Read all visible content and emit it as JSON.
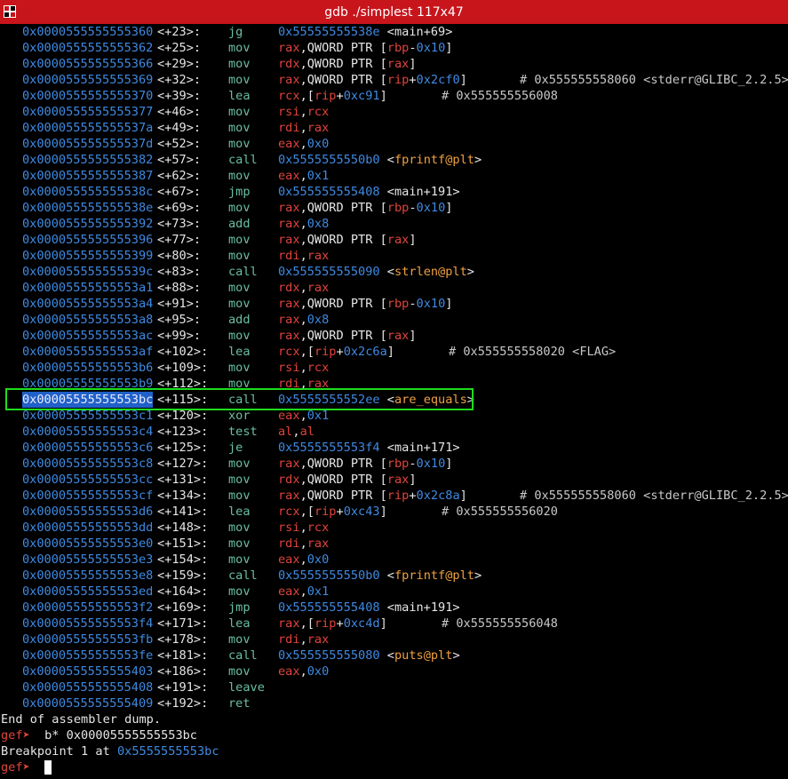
{
  "window": {
    "title": "gdb ./simplest 117x47"
  },
  "rows": [
    {
      "addr": "0x0000555555555360",
      "off": "<+23>:",
      "mn": "jg",
      "ops": [
        {
          "t": "0x55555555538e",
          "c": "num"
        },
        {
          "t": " ",
          "c": "txt"
        },
        {
          "t": "<",
          "c": "txt"
        },
        {
          "t": "main+69",
          "c": "txt"
        },
        {
          "t": ">",
          "c": "txt"
        }
      ],
      "cm": ""
    },
    {
      "addr": "0x0000555555555362",
      "off": "<+25>:",
      "mn": "mov",
      "ops": [
        {
          "t": "rax",
          "c": "reg"
        },
        {
          "t": ",QWORD PTR [",
          "c": "txt"
        },
        {
          "t": "rbp",
          "c": "reg"
        },
        {
          "t": "-",
          "c": "txt"
        },
        {
          "t": "0x10",
          "c": "num"
        },
        {
          "t": "]",
          "c": "txt"
        }
      ],
      "cm": ""
    },
    {
      "addr": "0x0000555555555366",
      "off": "<+29>:",
      "mn": "mov",
      "ops": [
        {
          "t": "rdx",
          "c": "reg"
        },
        {
          "t": ",QWORD PTR [",
          "c": "txt"
        },
        {
          "t": "rax",
          "c": "reg"
        },
        {
          "t": "]",
          "c": "txt"
        }
      ],
      "cm": ""
    },
    {
      "addr": "0x0000555555555369",
      "off": "<+32>:",
      "mn": "mov",
      "ops": [
        {
          "t": "rax",
          "c": "reg"
        },
        {
          "t": ",QWORD PTR [",
          "c": "txt"
        },
        {
          "t": "rip",
          "c": "reg"
        },
        {
          "t": "+",
          "c": "txt"
        },
        {
          "t": "0x2cf0",
          "c": "num"
        },
        {
          "t": "]",
          "c": "txt"
        }
      ],
      "cm": "# 0x555555558060 <stderr@GLIBC_2.2.5>",
      "cmx": 585
    },
    {
      "addr": "0x0000555555555370",
      "off": "<+39>:",
      "mn": "lea",
      "ops": [
        {
          "t": "rcx",
          "c": "reg"
        },
        {
          "t": ",[",
          "c": "txt"
        },
        {
          "t": "rip",
          "c": "reg"
        },
        {
          "t": "+",
          "c": "txt"
        },
        {
          "t": "0xc91",
          "c": "num"
        },
        {
          "t": "]",
          "c": "txt"
        }
      ],
      "cm": "# 0x555555556008",
      "cmx": 497
    },
    {
      "addr": "0x0000555555555377",
      "off": "<+46>:",
      "mn": "mov",
      "ops": [
        {
          "t": "rsi",
          "c": "reg"
        },
        {
          "t": ",",
          "c": "txt"
        },
        {
          "t": "rcx",
          "c": "reg"
        }
      ],
      "cm": ""
    },
    {
      "addr": "0x000055555555537a",
      "off": "<+49>:",
      "mn": "mov",
      "ops": [
        {
          "t": "rdi",
          "c": "reg"
        },
        {
          "t": ",",
          "c": "txt"
        },
        {
          "t": "rax",
          "c": "reg"
        }
      ],
      "cm": ""
    },
    {
      "addr": "0x000055555555537d",
      "off": "<+52>:",
      "mn": "mov",
      "ops": [
        {
          "t": "eax",
          "c": "reg"
        },
        {
          "t": ",",
          "c": "txt"
        },
        {
          "t": "0x0",
          "c": "num"
        }
      ],
      "cm": ""
    },
    {
      "addr": "0x0000555555555382",
      "off": "<+57>:",
      "mn": "call",
      "ops": [
        {
          "t": "0x5555555550b0",
          "c": "num"
        },
        {
          "t": " <",
          "c": "txt"
        },
        {
          "t": "fprintf@plt",
          "c": "sym"
        },
        {
          "t": ">",
          "c": "txt"
        }
      ],
      "cm": ""
    },
    {
      "addr": "0x0000555555555387",
      "off": "<+62>:",
      "mn": "mov",
      "ops": [
        {
          "t": "eax",
          "c": "reg"
        },
        {
          "t": ",",
          "c": "txt"
        },
        {
          "t": "0x1",
          "c": "num"
        }
      ],
      "cm": ""
    },
    {
      "addr": "0x000055555555538c",
      "off": "<+67>:",
      "mn": "jmp",
      "ops": [
        {
          "t": "0x555555555408",
          "c": "num"
        },
        {
          "t": " <main+191>",
          "c": "txt"
        }
      ],
      "cm": ""
    },
    {
      "addr": "0x000055555555538e",
      "off": "<+69>:",
      "mn": "mov",
      "ops": [
        {
          "t": "rax",
          "c": "reg"
        },
        {
          "t": ",QWORD PTR [",
          "c": "txt"
        },
        {
          "t": "rbp",
          "c": "reg"
        },
        {
          "t": "-",
          "c": "txt"
        },
        {
          "t": "0x10",
          "c": "num"
        },
        {
          "t": "]",
          "c": "txt"
        }
      ],
      "cm": ""
    },
    {
      "addr": "0x0000555555555392",
      "off": "<+73>:",
      "mn": "add",
      "ops": [
        {
          "t": "rax",
          "c": "reg"
        },
        {
          "t": ",",
          "c": "txt"
        },
        {
          "t": "0x8",
          "c": "num"
        }
      ],
      "cm": ""
    },
    {
      "addr": "0x0000555555555396",
      "off": "<+77>:",
      "mn": "mov",
      "ops": [
        {
          "t": "rax",
          "c": "reg"
        },
        {
          "t": ",QWORD PTR [",
          "c": "txt"
        },
        {
          "t": "rax",
          "c": "reg"
        },
        {
          "t": "]",
          "c": "txt"
        }
      ],
      "cm": ""
    },
    {
      "addr": "0x0000555555555399",
      "off": "<+80>:",
      "mn": "mov",
      "ops": [
        {
          "t": "rdi",
          "c": "reg"
        },
        {
          "t": ",",
          "c": "txt"
        },
        {
          "t": "rax",
          "c": "reg"
        }
      ],
      "cm": ""
    },
    {
      "addr": "0x000055555555539c",
      "off": "<+83>:",
      "mn": "call",
      "ops": [
        {
          "t": "0x555555555090",
          "c": "num"
        },
        {
          "t": " <",
          "c": "txt"
        },
        {
          "t": "strlen@plt",
          "c": "sym"
        },
        {
          "t": ">",
          "c": "txt"
        }
      ],
      "cm": ""
    },
    {
      "addr": "0x00005555555553a1",
      "off": "<+88>:",
      "mn": "mov",
      "ops": [
        {
          "t": "rdx",
          "c": "reg"
        },
        {
          "t": ",",
          "c": "txt"
        },
        {
          "t": "rax",
          "c": "reg"
        }
      ],
      "cm": ""
    },
    {
      "addr": "0x00005555555553a4",
      "off": "<+91>:",
      "mn": "mov",
      "ops": [
        {
          "t": "rax",
          "c": "reg"
        },
        {
          "t": ",QWORD PTR [",
          "c": "txt"
        },
        {
          "t": "rbp",
          "c": "reg"
        },
        {
          "t": "-",
          "c": "txt"
        },
        {
          "t": "0x10",
          "c": "num"
        },
        {
          "t": "]",
          "c": "txt"
        }
      ],
      "cm": ""
    },
    {
      "addr": "0x00005555555553a8",
      "off": "<+95>:",
      "mn": "add",
      "ops": [
        {
          "t": "rax",
          "c": "reg"
        },
        {
          "t": ",",
          "c": "txt"
        },
        {
          "t": "0x8",
          "c": "num"
        }
      ],
      "cm": ""
    },
    {
      "addr": "0x00005555555553ac",
      "off": "<+99>:",
      "mn": "mov",
      "ops": [
        {
          "t": "rax",
          "c": "reg"
        },
        {
          "t": ",QWORD PTR [",
          "c": "txt"
        },
        {
          "t": "rax",
          "c": "reg"
        },
        {
          "t": "]",
          "c": "txt"
        }
      ],
      "cm": ""
    },
    {
      "addr": "0x00005555555553af",
      "off": "<+102>:",
      "mn": "lea",
      "ops": [
        {
          "t": "rcx",
          "c": "reg"
        },
        {
          "t": ",[",
          "c": "txt"
        },
        {
          "t": "rip",
          "c": "reg"
        },
        {
          "t": "+",
          "c": "txt"
        },
        {
          "t": "0x2c6a",
          "c": "num"
        },
        {
          "t": "]",
          "c": "txt"
        }
      ],
      "cm": "# 0x555555558020 <FLAG>",
      "cmx": 505
    },
    {
      "addr": "0x00005555555553b6",
      "off": "<+109>:",
      "mn": "mov",
      "ops": [
        {
          "t": "rsi",
          "c": "reg"
        },
        {
          "t": ",",
          "c": "txt"
        },
        {
          "t": "rcx",
          "c": "reg"
        }
      ],
      "cm": ""
    },
    {
      "addr": "0x00005555555553b9",
      "off": "<+112>:",
      "mn": "mov",
      "ops": [
        {
          "t": "rdi",
          "c": "reg"
        },
        {
          "t": ",",
          "c": "txt"
        },
        {
          "t": "rax",
          "c": "reg"
        }
      ],
      "cm": ""
    },
    {
      "addr": "0x00005555555553bc",
      "off": "<+115>:",
      "mn": "call",
      "ops": [
        {
          "t": "0x5555555552ee",
          "c": "num"
        },
        {
          "t": " <",
          "c": "txt"
        },
        {
          "t": "are_equals",
          "c": "sym"
        },
        {
          "t": ">",
          "c": "txt"
        }
      ],
      "cm": "",
      "selected": true
    },
    {
      "addr": "0x00005555555553c1",
      "off": "<+120>:",
      "mn": "xor",
      "ops": [
        {
          "t": "eax",
          "c": "reg"
        },
        {
          "t": ",",
          "c": "txt"
        },
        {
          "t": "0x1",
          "c": "num"
        }
      ],
      "cm": ""
    },
    {
      "addr": "0x00005555555553c4",
      "off": "<+123>:",
      "mn": "test",
      "ops": [
        {
          "t": "al",
          "c": "reg"
        },
        {
          "t": ",",
          "c": "txt"
        },
        {
          "t": "al",
          "c": "reg"
        }
      ],
      "cm": ""
    },
    {
      "addr": "0x00005555555553c6",
      "off": "<+125>:",
      "mn": "je",
      "ops": [
        {
          "t": "0x5555555553f4",
          "c": "num"
        },
        {
          "t": " <main+171>",
          "c": "txt"
        }
      ],
      "cm": ""
    },
    {
      "addr": "0x00005555555553c8",
      "off": "<+127>:",
      "mn": "mov",
      "ops": [
        {
          "t": "rax",
          "c": "reg"
        },
        {
          "t": ",QWORD PTR [",
          "c": "txt"
        },
        {
          "t": "rbp",
          "c": "reg"
        },
        {
          "t": "-",
          "c": "txt"
        },
        {
          "t": "0x10",
          "c": "num"
        },
        {
          "t": "]",
          "c": "txt"
        }
      ],
      "cm": ""
    },
    {
      "addr": "0x00005555555553cc",
      "off": "<+131>:",
      "mn": "mov",
      "ops": [
        {
          "t": "rdx",
          "c": "reg"
        },
        {
          "t": ",QWORD PTR [",
          "c": "txt"
        },
        {
          "t": "rax",
          "c": "reg"
        },
        {
          "t": "]",
          "c": "txt"
        }
      ],
      "cm": ""
    },
    {
      "addr": "0x00005555555553cf",
      "off": "<+134>:",
      "mn": "mov",
      "ops": [
        {
          "t": "rax",
          "c": "reg"
        },
        {
          "t": ",QWORD PTR [",
          "c": "txt"
        },
        {
          "t": "rip",
          "c": "reg"
        },
        {
          "t": "+",
          "c": "txt"
        },
        {
          "t": "0x2c8a",
          "c": "num"
        },
        {
          "t": "]",
          "c": "txt"
        }
      ],
      "cm": "# 0x555555558060 <stderr@GLIBC_2.2.5>",
      "cmx": 585
    },
    {
      "addr": "0x00005555555553d6",
      "off": "<+141>:",
      "mn": "lea",
      "ops": [
        {
          "t": "rcx",
          "c": "reg"
        },
        {
          "t": ",[",
          "c": "txt"
        },
        {
          "t": "rip",
          "c": "reg"
        },
        {
          "t": "+",
          "c": "txt"
        },
        {
          "t": "0xc43",
          "c": "num"
        },
        {
          "t": "]",
          "c": "txt"
        }
      ],
      "cm": "# 0x555555556020",
      "cmx": 497
    },
    {
      "addr": "0x00005555555553dd",
      "off": "<+148>:",
      "mn": "mov",
      "ops": [
        {
          "t": "rsi",
          "c": "reg"
        },
        {
          "t": ",",
          "c": "txt"
        },
        {
          "t": "rcx",
          "c": "reg"
        }
      ],
      "cm": ""
    },
    {
      "addr": "0x00005555555553e0",
      "off": "<+151>:",
      "mn": "mov",
      "ops": [
        {
          "t": "rdi",
          "c": "reg"
        },
        {
          "t": ",",
          "c": "txt"
        },
        {
          "t": "rax",
          "c": "reg"
        }
      ],
      "cm": ""
    },
    {
      "addr": "0x00005555555553e3",
      "off": "<+154>:",
      "mn": "mov",
      "ops": [
        {
          "t": "eax",
          "c": "reg"
        },
        {
          "t": ",",
          "c": "txt"
        },
        {
          "t": "0x0",
          "c": "num"
        }
      ],
      "cm": ""
    },
    {
      "addr": "0x00005555555553e8",
      "off": "<+159>:",
      "mn": "call",
      "ops": [
        {
          "t": "0x5555555550b0",
          "c": "num"
        },
        {
          "t": " <",
          "c": "txt"
        },
        {
          "t": "fprintf@plt",
          "c": "sym"
        },
        {
          "t": ">",
          "c": "txt"
        }
      ],
      "cm": ""
    },
    {
      "addr": "0x00005555555553ed",
      "off": "<+164>:",
      "mn": "mov",
      "ops": [
        {
          "t": "eax",
          "c": "reg"
        },
        {
          "t": ",",
          "c": "txt"
        },
        {
          "t": "0x1",
          "c": "num"
        }
      ],
      "cm": ""
    },
    {
      "addr": "0x00005555555553f2",
      "off": "<+169>:",
      "mn": "jmp",
      "ops": [
        {
          "t": "0x555555555408",
          "c": "num"
        },
        {
          "t": " <main+191>",
          "c": "txt"
        }
      ],
      "cm": ""
    },
    {
      "addr": "0x00005555555553f4",
      "off": "<+171>:",
      "mn": "lea",
      "ops": [
        {
          "t": "rax",
          "c": "reg"
        },
        {
          "t": ",[",
          "c": "txt"
        },
        {
          "t": "rip",
          "c": "reg"
        },
        {
          "t": "+",
          "c": "txt"
        },
        {
          "t": "0xc4d",
          "c": "num"
        },
        {
          "t": "]",
          "c": "txt"
        }
      ],
      "cm": "# 0x555555556048",
      "cmx": 497
    },
    {
      "addr": "0x00005555555553fb",
      "off": "<+178>:",
      "mn": "mov",
      "ops": [
        {
          "t": "rdi",
          "c": "reg"
        },
        {
          "t": ",",
          "c": "txt"
        },
        {
          "t": "rax",
          "c": "reg"
        }
      ],
      "cm": ""
    },
    {
      "addr": "0x00005555555553fe",
      "off": "<+181>:",
      "mn": "call",
      "ops": [
        {
          "t": "0x555555555080",
          "c": "num"
        },
        {
          "t": " <",
          "c": "txt"
        },
        {
          "t": "puts@plt",
          "c": "sym"
        },
        {
          "t": ">",
          "c": "txt"
        }
      ],
      "cm": ""
    },
    {
      "addr": "0x0000555555555403",
      "off": "<+186>:",
      "mn": "mov",
      "ops": [
        {
          "t": "eax",
          "c": "reg"
        },
        {
          "t": ",",
          "c": "txt"
        },
        {
          "t": "0x0",
          "c": "num"
        }
      ],
      "cm": ""
    },
    {
      "addr": "0x0000555555555408",
      "off": "<+191>:",
      "mn": "leave",
      "ops": [],
      "cm": ""
    },
    {
      "addr": "0x0000555555555409",
      "off": "<+192>:",
      "mn": "ret",
      "ops": [],
      "cm": ""
    }
  ],
  "footer": {
    "end_msg": "End of assembler dump.",
    "prompt": "gef➤",
    "command": "b* 0x00005555555553bc",
    "bp_text": "Breakpoint 1 at ",
    "bp_addr": "0x5555555553bc"
  },
  "colors": {
    "titlebar": "#c8141b",
    "address": "#3f8ae2",
    "register": "#e0443a",
    "mnemonic": "#6bbfa4",
    "symbol": "#f0a040",
    "highlight_box": "#1edc1e"
  }
}
